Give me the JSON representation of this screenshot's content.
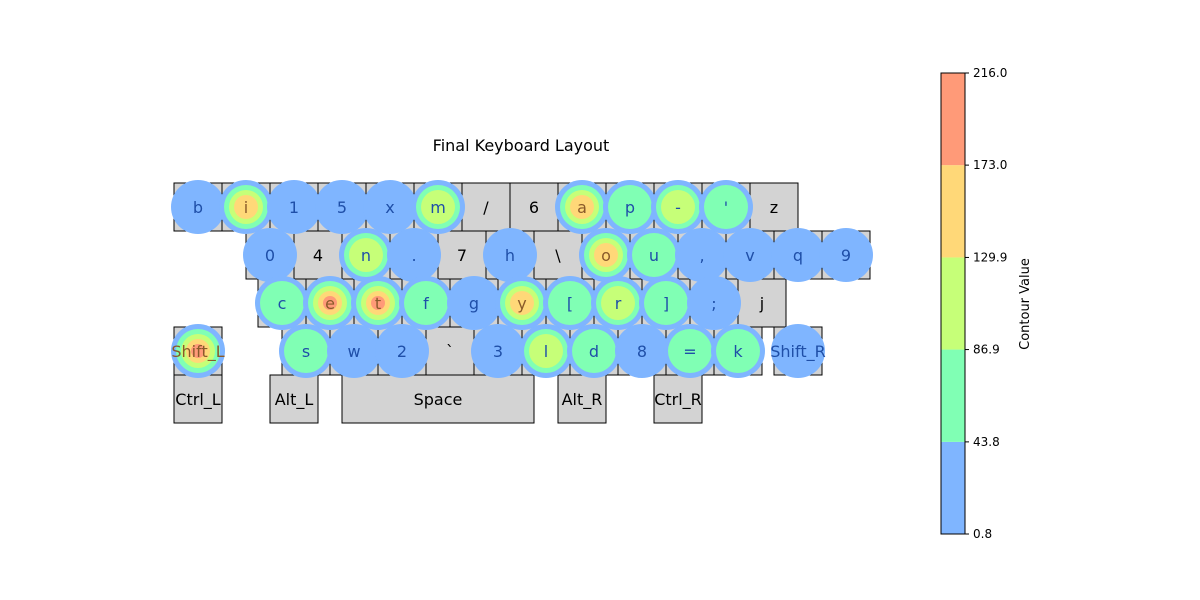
{
  "chart_data": {
    "type": "heatmap",
    "title": "Final Keyboard Layout",
    "colorbar": {
      "label": "Contour Value",
      "ticks": [
        "0.8",
        "43.8",
        "86.9",
        "129.9",
        "173.0",
        "216.0"
      ],
      "range": [
        0.8,
        216.0
      ],
      "bands": [
        {
          "from": 0.8,
          "to": 43.8,
          "color": "#7fb5ff"
        },
        {
          "from": 43.8,
          "to": 86.9,
          "color": "#80ffb4"
        },
        {
          "from": 86.9,
          "to": 129.9,
          "color": "#c6ff78"
        },
        {
          "from": 129.9,
          "to": 173.0,
          "color": "#ffd878"
        },
        {
          "from": 173.0,
          "to": 216.0,
          "color": "#ff9a78"
        }
      ]
    },
    "rows": [
      [
        {
          "label": "b",
          "value": 30
        },
        {
          "label": "i",
          "value": 150
        },
        {
          "label": "1",
          "value": 25
        },
        {
          "label": "5",
          "value": 25
        },
        {
          "label": "x",
          "value": 20
        },
        {
          "label": "m",
          "value": 100
        },
        {
          "label": "/",
          "value": 0
        },
        {
          "label": "6",
          "value": 0
        },
        {
          "label": "a",
          "value": 170
        },
        {
          "label": "p",
          "value": 60
        },
        {
          "label": "-",
          "value": 95
        },
        {
          "label": "'",
          "value": 70
        },
        {
          "label": "z",
          "value": 0
        }
      ],
      [
        {
          "label": "0",
          "value": 20
        },
        {
          "label": "4",
          "value": 0
        },
        {
          "label": "n",
          "value": 120
        },
        {
          "label": ".",
          "value": 20
        },
        {
          "label": "7",
          "value": 0
        },
        {
          "label": "h",
          "value": 25
        },
        {
          "label": "\\",
          "value": 0
        },
        {
          "label": "o",
          "value": 165
        },
        {
          "label": "u",
          "value": 80
        },
        {
          "label": ",",
          "value": 15
        },
        {
          "label": "v",
          "value": 15
        },
        {
          "label": "q",
          "value": 15
        },
        {
          "label": "9",
          "value": 15
        }
      ],
      [
        {
          "label": "c",
          "value": 80
        },
        {
          "label": "e",
          "value": 205
        },
        {
          "label": "t",
          "value": 200
        },
        {
          "label": "f",
          "value": 65
        },
        {
          "label": "g",
          "value": 25
        },
        {
          "label": "y",
          "value": 150
        },
        {
          "label": "[",
          "value": 60
        },
        {
          "label": "r",
          "value": 120
        },
        {
          "label": "]",
          "value": 60
        },
        {
          "label": ";",
          "value": 15
        },
        {
          "label": "j",
          "value": 0
        }
      ],
      [
        {
          "label": "Shift_L",
          "value": 200
        },
        {
          "label": "s",
          "value": 75
        },
        {
          "label": "w",
          "value": 25
        },
        {
          "label": "2",
          "value": 20
        },
        {
          "label": "`",
          "value": 0
        },
        {
          "label": "3",
          "value": 25
        },
        {
          "label": "l",
          "value": 120
        },
        {
          "label": "d",
          "value": 70
        },
        {
          "label": "8",
          "value": 25
        },
        {
          "label": "=",
          "value": 70
        },
        {
          "label": "k",
          "value": 75
        },
        {
          "label": "Shift_R",
          "value": 25
        }
      ],
      [
        {
          "label": "Ctrl_L",
          "value": 0
        },
        {
          "label": "Alt_L",
          "value": 0
        },
        {
          "label": "Space",
          "value": 0
        },
        {
          "label": "Alt_R",
          "value": 0
        },
        {
          "label": "Ctrl_R",
          "value": 0
        }
      ]
    ],
    "key_color": "#d3d3d3",
    "grid": false
  }
}
